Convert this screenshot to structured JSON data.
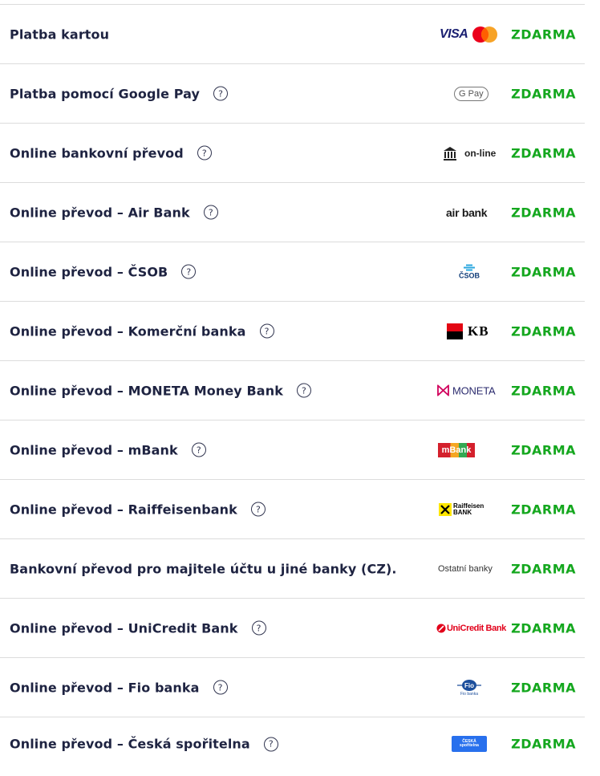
{
  "methods": [
    {
      "label": "Platba kartou",
      "price": "ZDARMA",
      "logo": "visa-mastercard-logo",
      "logo_text": "VISA",
      "help": false
    },
    {
      "label": "Platba pomocí Google Pay",
      "price": "ZDARMA",
      "logo": "google-pay-logo",
      "logo_text": "G Pay",
      "help": true
    },
    {
      "label": "Online bankovní převod",
      "price": "ZDARMA",
      "logo": "bank-online-logo",
      "logo_text": "on-line",
      "help": true
    },
    {
      "label": "Online převod – Air Bank",
      "price": "ZDARMA",
      "logo": "air-bank-logo",
      "logo_text": "air bank",
      "help": true
    },
    {
      "label": "Online převod – ČSOB",
      "price": "ZDARMA",
      "logo": "csob-logo",
      "logo_text": "ČSOB",
      "help": true
    },
    {
      "label": "Online převod – Komerční banka",
      "price": "ZDARMA",
      "logo": "kb-logo",
      "logo_text": "KB",
      "help": true
    },
    {
      "label": "Online převod – MONETA Money Bank",
      "price": "ZDARMA",
      "logo": "moneta-logo",
      "logo_text": "MONETA",
      "help": true
    },
    {
      "label": "Online převod – mBank",
      "price": "ZDARMA",
      "logo": "mbank-logo",
      "logo_text": "mBank",
      "help": true
    },
    {
      "label": "Online převod – Raiffeisenbank",
      "price": "ZDARMA",
      "logo": "raiffeisen-logo",
      "logo_text": "Raiffeisen BANK",
      "help": true
    },
    {
      "label": "Bankovní převod pro majitele účtu u jiné banky (CZ).",
      "price": "ZDARMA",
      "logo": "other-banks-logo",
      "logo_text": "Ostatní banky",
      "help": false
    },
    {
      "label": "Online převod – UniCredit Bank",
      "price": "ZDARMA",
      "logo": "unicredit-logo",
      "logo_text": "UniCredit Bank",
      "help": true
    },
    {
      "label": "Online převod – Fio banka",
      "price": "ZDARMA",
      "logo": "fio-logo",
      "logo_text": "Fio banka",
      "help": true
    },
    {
      "label": "Online převod – Česká spořitelna",
      "price": "ZDARMA",
      "logo": "ceska-sporitelna-logo",
      "logo_text": "ČESKÁ spořitelna",
      "help": true
    }
  ],
  "help_glyph": "?",
  "colors": {
    "price": "#14a71e",
    "text": "#1e2341",
    "divider": "#dcdcdc"
  }
}
